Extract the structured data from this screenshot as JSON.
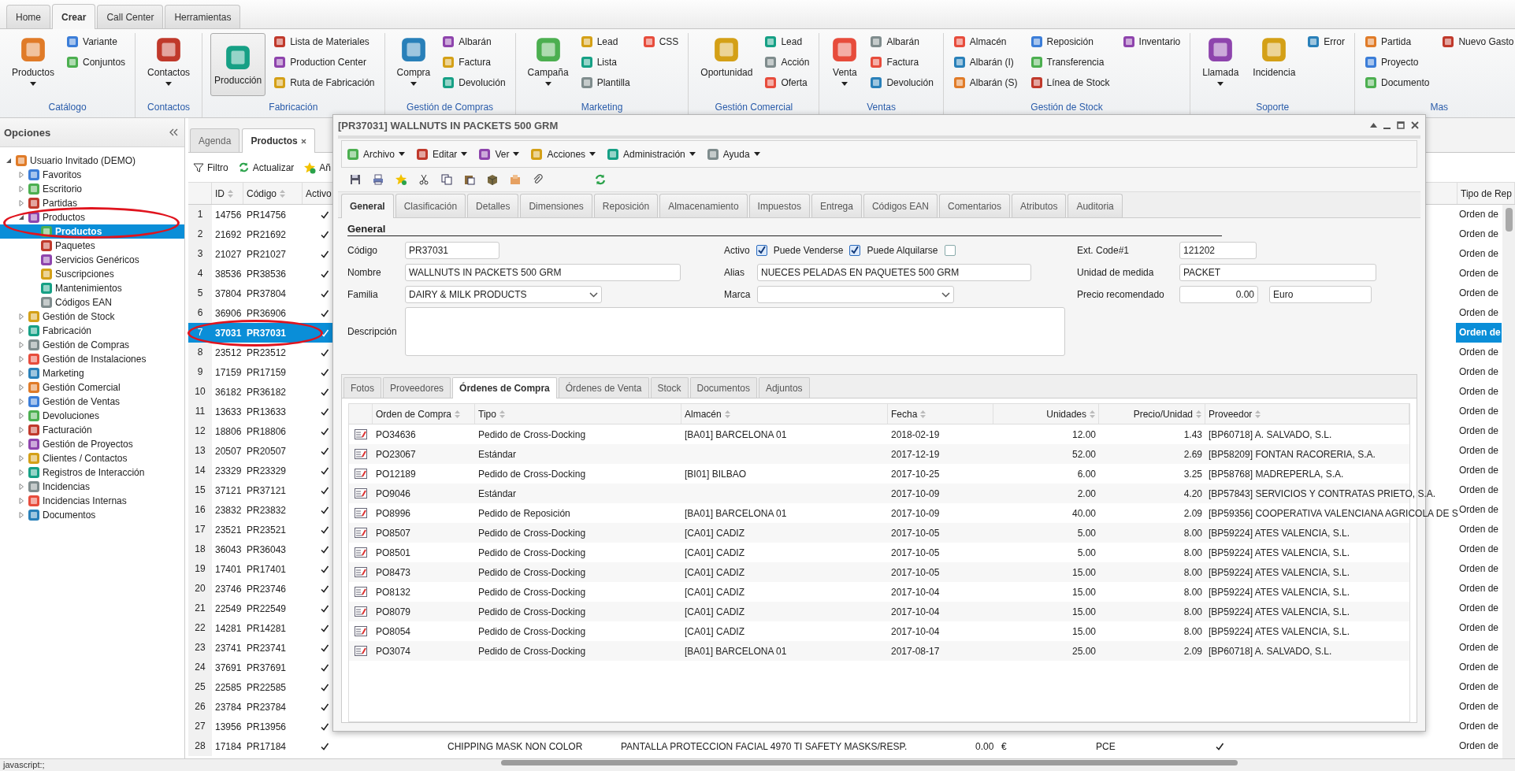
{
  "ribbon": {
    "tabs": [
      {
        "label": "Home",
        "selected": false
      },
      {
        "label": "Crear",
        "selected": true
      },
      {
        "label": "Call Center",
        "selected": false
      },
      {
        "label": "Herramientas",
        "selected": false
      }
    ],
    "groups": [
      {
        "label": "Catálogo",
        "large": [
          {
            "label": "Productos",
            "dropdown": true,
            "selected": false
          }
        ],
        "small": [
          "Variante",
          "Conjuntos"
        ]
      },
      {
        "label": "Contactos",
        "large": [
          {
            "label": "Contactos",
            "dropdown": true,
            "selected": false
          }
        ]
      },
      {
        "label": "Fabricación",
        "large": [
          {
            "label": "Producción",
            "dropdown": false,
            "selected": true
          }
        ],
        "small": [
          "Lista de Materiales",
          "Production Center",
          "Ruta de Fabricación"
        ]
      },
      {
        "label": "Gestión de Compras",
        "large": [
          {
            "label": "Compra",
            "dropdown": true,
            "selected": false
          }
        ],
        "small": [
          "Albarán",
          "Factura",
          "Devolución"
        ]
      },
      {
        "label": "Marketing",
        "large": [
          {
            "label": "Campaña",
            "dropdown": true,
            "selected": false
          }
        ],
        "small": [
          "Lead",
          "Lista",
          "Plantilla",
          "CSS"
        ]
      },
      {
        "label": "Gestión Comercial",
        "large": [
          {
            "label": "Oportunidad",
            "dropdown": false,
            "selected": false
          }
        ],
        "small": [
          "Lead",
          "Acción",
          "Oferta"
        ]
      },
      {
        "label": "Ventas",
        "large": [
          {
            "label": "Venta",
            "dropdown": true,
            "selected": false
          }
        ],
        "small": [
          "Albarán",
          "Factura",
          "Devolución"
        ]
      },
      {
        "label": "Gestión de Stock",
        "small": [
          "Almacén",
          "Albarán (I)",
          "Albarán (S)",
          "Reposición",
          "Transferencia",
          "Línea de Stock",
          "Inventario"
        ]
      },
      {
        "label": "Soporte",
        "large": [
          {
            "label": "Llamada",
            "dropdown": true,
            "selected": false
          },
          {
            "label": "Incidencia",
            "dropdown": false,
            "selected": false
          }
        ],
        "small": [
          "Error"
        ]
      },
      {
        "label": "Mas",
        "small": [
          "Partida",
          "Proyecto",
          "Documento",
          "Nuevo Gasto"
        ]
      }
    ]
  },
  "sidebar": {
    "title": "Opciones",
    "items": [
      {
        "label": "Usuario Invitado (DEMO)",
        "expanded": true,
        "selected": false,
        "children": [
          {
            "label": "Favoritos",
            "expanded": false,
            "selected": false
          },
          {
            "label": "Escritorio",
            "expanded": false,
            "selected": false
          },
          {
            "label": "Partidas",
            "expanded": false,
            "selected": false
          },
          {
            "label": "Productos",
            "expanded": true,
            "selected": false,
            "children": [
              {
                "label": "Productos",
                "selected": true
              },
              {
                "label": "Paquetes",
                "selected": false
              },
              {
                "label": "Servicios Genéricos",
                "selected": false
              },
              {
                "label": "Suscripciones",
                "selected": false
              },
              {
                "label": "Mantenimientos",
                "selected": false
              },
              {
                "label": "Códigos EAN",
                "selected": false
              }
            ]
          },
          {
            "label": "Gestión de Stock",
            "expanded": false,
            "selected": false
          },
          {
            "label": "Fabricación",
            "expanded": false,
            "selected": false
          },
          {
            "label": "Gestión de Compras",
            "expanded": false,
            "selected": false
          },
          {
            "label": "Gestión de Instalaciones",
            "expanded": false,
            "selected": false
          },
          {
            "label": "Marketing",
            "expanded": false,
            "selected": false
          },
          {
            "label": "Gestión Comercial",
            "expanded": false,
            "selected": false
          },
          {
            "label": "Gestión de Ventas",
            "expanded": false,
            "selected": false
          },
          {
            "label": "Devoluciones",
            "expanded": false,
            "selected": false
          },
          {
            "label": "Facturación",
            "expanded": false,
            "selected": false
          },
          {
            "label": "Gestión de Proyectos",
            "expanded": false,
            "selected": false
          },
          {
            "label": "Clientes / Contactos",
            "expanded": false,
            "selected": false
          },
          {
            "label": "Registros de Interacción",
            "expanded": false,
            "selected": false
          },
          {
            "label": "Incidencias",
            "expanded": false,
            "selected": false
          },
          {
            "label": "Incidencias Internas",
            "expanded": false,
            "selected": false
          },
          {
            "label": "Documentos",
            "expanded": false,
            "selected": false
          }
        ]
      }
    ]
  },
  "main_tabs": [
    {
      "label": "Agenda",
      "selected": false,
      "closable": false
    },
    {
      "label": "Productos",
      "selected": true,
      "closable": true
    }
  ],
  "toolbar": [
    "Filtro",
    "Actualizar",
    "Añ"
  ],
  "product_grid": {
    "columns": [
      "ID",
      "Código",
      "Activo",
      "Tipo de Rep"
    ],
    "rows": [
      {
        "n": "1",
        "id": "14756",
        "code": "PR14756",
        "active": true,
        "selected": false,
        "tipo": "Orden de"
      },
      {
        "n": "2",
        "id": "21692",
        "code": "PR21692",
        "active": true,
        "selected": false,
        "tipo": "Orden de"
      },
      {
        "n": "3",
        "id": "21027",
        "code": "PR21027",
        "active": true,
        "selected": false,
        "tipo": "Orden de"
      },
      {
        "n": "4",
        "id": "38536",
        "code": "PR38536",
        "active": true,
        "selected": false,
        "tipo": "Orden de"
      },
      {
        "n": "5",
        "id": "37804",
        "code": "PR37804",
        "active": true,
        "selected": false,
        "tipo": "Orden de"
      },
      {
        "n": "6",
        "id": "36906",
        "code": "PR36906",
        "active": true,
        "selected": false,
        "tipo": "Orden de"
      },
      {
        "n": "7",
        "id": "37031",
        "code": "PR37031",
        "active": true,
        "selected": true,
        "tipo": "Orden de"
      },
      {
        "n": "8",
        "id": "23512",
        "code": "PR23512",
        "active": true,
        "selected": false,
        "tipo": "Orden de"
      },
      {
        "n": "9",
        "id": "17159",
        "code": "PR17159",
        "active": true,
        "selected": false,
        "tipo": "Orden de"
      },
      {
        "n": "10",
        "id": "36182",
        "code": "PR36182",
        "active": true,
        "selected": false,
        "tipo": "Orden de"
      },
      {
        "n": "11",
        "id": "13633",
        "code": "PR13633",
        "active": true,
        "selected": false,
        "tipo": "Orden de"
      },
      {
        "n": "12",
        "id": "18806",
        "code": "PR18806",
        "active": true,
        "selected": false,
        "tipo": "Orden de"
      },
      {
        "n": "13",
        "id": "20507",
        "code": "PR20507",
        "active": true,
        "selected": false,
        "tipo": "Orden de"
      },
      {
        "n": "14",
        "id": "23329",
        "code": "PR23329",
        "active": true,
        "selected": false,
        "tipo": "Orden de"
      },
      {
        "n": "15",
        "id": "37121",
        "code": "PR37121",
        "active": true,
        "selected": false,
        "tipo": "Orden de"
      },
      {
        "n": "16",
        "id": "23832",
        "code": "PR23832",
        "active": true,
        "selected": false,
        "tipo": "Orden de"
      },
      {
        "n": "17",
        "id": "23521",
        "code": "PR23521",
        "active": true,
        "selected": false,
        "tipo": "Orden de"
      },
      {
        "n": "18",
        "id": "36043",
        "code": "PR36043",
        "active": true,
        "selected": false,
        "tipo": "Orden de"
      },
      {
        "n": "19",
        "id": "17401",
        "code": "PR17401",
        "active": true,
        "selected": false,
        "tipo": "Orden de"
      },
      {
        "n": "20",
        "id": "23746",
        "code": "PR23746",
        "active": true,
        "selected": false,
        "tipo": "Orden de"
      },
      {
        "n": "21",
        "id": "22549",
        "code": "PR22549",
        "active": true,
        "selected": false,
        "tipo": "Orden de"
      },
      {
        "n": "22",
        "id": "14281",
        "code": "PR14281",
        "active": true,
        "selected": false,
        "tipo": "Orden de"
      },
      {
        "n": "23",
        "id": "23741",
        "code": "PR23741",
        "active": true,
        "selected": false,
        "tipo": "Orden de"
      },
      {
        "n": "24",
        "id": "37691",
        "code": "PR37691",
        "active": true,
        "selected": false,
        "tipo": "Orden de"
      },
      {
        "n": "25",
        "id": "22585",
        "code": "PR22585",
        "active": true,
        "selected": false,
        "tipo": "Orden de"
      },
      {
        "n": "26",
        "id": "23784",
        "code": "PR23784",
        "active": true,
        "selected": false,
        "tipo": "Orden de"
      },
      {
        "n": "27",
        "id": "13956",
        "code": "PR13956",
        "active": true,
        "selected": false,
        "tipo": "Orden de"
      },
      {
        "n": "28",
        "id": "17184",
        "code": "PR17184",
        "active": true,
        "selected": false,
        "tipo": "Orden de",
        "extra": [
          "CHIPPING MASK NON COLOR",
          "PANTALLA PROTECCION FACIAL 4970 TI SAFETY MASKS/RESP.",
          "0.00",
          "€",
          "PCE"
        ],
        "extra_check": true
      }
    ]
  },
  "dialog": {
    "title": "[PR37031] WALLNUTS IN PACKETS 500 GRM",
    "menu": [
      "Archivo",
      "Editar",
      "Ver",
      "Acciones",
      "Administración",
      "Ayuda"
    ],
    "tabs": [
      {
        "label": "General",
        "selected": true
      },
      {
        "label": "Clasificación",
        "selected": false
      },
      {
        "label": "Detalles",
        "selected": false
      },
      {
        "label": "Dimensiones",
        "selected": false
      },
      {
        "label": "Reposición",
        "selected": false
      },
      {
        "label": "Almacenamiento",
        "selected": false
      },
      {
        "label": "Impuestos",
        "selected": false
      },
      {
        "label": "Entrega",
        "selected": false
      },
      {
        "label": "Códigos EAN",
        "selected": false
      },
      {
        "label": "Comentarios",
        "selected": false
      },
      {
        "label": "Atributos",
        "selected": false
      },
      {
        "label": "Auditoria",
        "selected": false
      }
    ],
    "section": "General",
    "fields": [
      {
        "kind": "text",
        "label": "Código",
        "value": "PR37031"
      },
      {
        "kind": "checkbox",
        "label": "Activo",
        "checked": true
      },
      {
        "kind": "checkbox",
        "label": "Puede Venderse",
        "checked": true
      },
      {
        "kind": "checkbox",
        "label": "Puede Alquilarse",
        "checked": false
      },
      {
        "kind": "text",
        "label": "Ext. Code#1",
        "value": "121202"
      },
      {
        "kind": "text",
        "label": "Nombre",
        "value": "WALLNUTS IN PACKETS 500 GRM"
      },
      {
        "kind": "text",
        "label": "Alias",
        "value": "NUECES PELADAS EN PAQUETES 500 GRM"
      },
      {
        "kind": "text",
        "label": "Unidad de medida",
        "value": "PACKET"
      },
      {
        "kind": "select",
        "label": "Familia",
        "value": "DAIRY & MILK PRODUCTS"
      },
      {
        "kind": "select",
        "label": "Marca"
      },
      {
        "kind": "number",
        "label": "Precio recomendado",
        "value": "0.00"
      },
      {
        "kind": "text",
        "value": "Euro"
      },
      {
        "kind": "textarea",
        "label": "Descripción"
      }
    ],
    "subtabs": [
      {
        "label": "Fotos",
        "selected": false
      },
      {
        "label": "Proveedores",
        "selected": false
      },
      {
        "label": "Órdenes de Compra",
        "selected": true
      },
      {
        "label": "Órdenes de Venta",
        "selected": false
      },
      {
        "label": "Stock",
        "selected": false
      },
      {
        "label": "Documentos",
        "selected": false
      },
      {
        "label": "Adjuntos",
        "selected": false
      }
    ],
    "table": {
      "columns": [
        "Orden de Compra",
        "Tipo",
        "Almacén",
        "Fecha",
        "Unidades",
        "Precio/Unidad",
        "Proveedor"
      ],
      "rows": [
        {
          "order": "PO34636",
          "type": "Pedido de Cross-Docking",
          "warehouse": "[BA01] BARCELONA 01",
          "date": "2018-02-19",
          "units": "12.00",
          "price": "1.43",
          "supplier": "[BP60718] A. SALVADO, S.L."
        },
        {
          "order": "PO23067",
          "type": "Estándar",
          "date": "2017-12-19",
          "units": "52.00",
          "price": "2.69",
          "supplier": "[BP58209] FONTAN RACORERIA, S.A."
        },
        {
          "order": "PO12189",
          "type": "Pedido de Cross-Docking",
          "warehouse": "[BI01] BILBAO",
          "date": "2017-10-25",
          "units": "6.00",
          "price": "3.25",
          "supplier": "[BP58768] MADREPERLA, S.A."
        },
        {
          "order": "PO9046",
          "type": "Estándar",
          "date": "2017-10-09",
          "units": "2.00",
          "price": "4.20",
          "supplier": "[BP57843] SERVICIOS Y CONTRATAS PRIETO, S.A."
        },
        {
          "order": "PO8996",
          "type": "Pedido de Reposición",
          "warehouse": "[BA01] BARCELONA 01",
          "date": "2017-10-09",
          "units": "40.00",
          "price": "2.09",
          "supplier": "[BP59356] COOPERATIVA VALENCIANA AGRICOLA DE S"
        },
        {
          "order": "PO8507",
          "type": "Pedido de Cross-Docking",
          "warehouse": "[CA01] CADIZ",
          "date": "2017-10-05",
          "units": "5.00",
          "price": "8.00",
          "supplier": "[BP59224] ATES VALENCIA, S.L."
        },
        {
          "order": "PO8501",
          "type": "Pedido de Cross-Docking",
          "warehouse": "[CA01] CADIZ",
          "date": "2017-10-05",
          "units": "5.00",
          "price": "8.00",
          "supplier": "[BP59224] ATES VALENCIA, S.L."
        },
        {
          "order": "PO8473",
          "type": "Pedido de Cross-Docking",
          "warehouse": "[CA01] CADIZ",
          "date": "2017-10-05",
          "units": "15.00",
          "price": "8.00",
          "supplier": "[BP59224] ATES VALENCIA, S.L."
        },
        {
          "order": "PO8132",
          "type": "Pedido de Cross-Docking",
          "warehouse": "[CA01] CADIZ",
          "date": "2017-10-04",
          "units": "15.00",
          "price": "8.00",
          "supplier": "[BP59224] ATES VALENCIA, S.L."
        },
        {
          "order": "PO8079",
          "type": "Pedido de Cross-Docking",
          "warehouse": "[CA01] CADIZ",
          "date": "2017-10-04",
          "units": "15.00",
          "price": "8.00",
          "supplier": "[BP59224] ATES VALENCIA, S.L."
        },
        {
          "order": "PO8054",
          "type": "Pedido de Cross-Docking",
          "warehouse": "[CA01] CADIZ",
          "date": "2017-10-04",
          "units": "15.00",
          "price": "8.00",
          "supplier": "[BP59224] ATES VALENCIA, S.L."
        },
        {
          "order": "PO3074",
          "type": "Pedido de Cross-Docking",
          "warehouse": "[BA01] BARCELONA 01",
          "date": "2017-08-17",
          "units": "25.00",
          "price": "2.09",
          "supplier": "[BP60718] A. SALVADO, S.L."
        }
      ]
    }
  },
  "status_bar": "javascript:;"
}
